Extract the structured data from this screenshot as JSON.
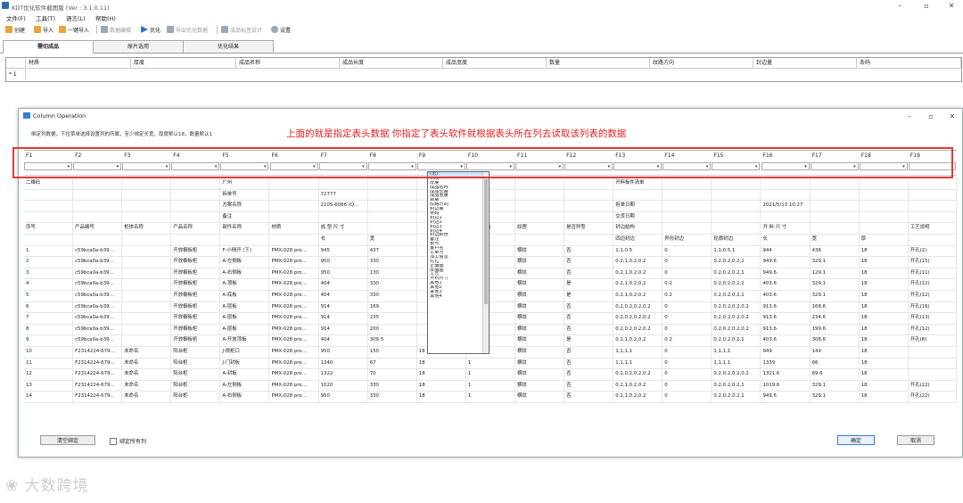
{
  "app": {
    "title": "KDT优化软件截图版 (Ver : 3.1.0.11)"
  },
  "menu": [
    "文件(F)",
    "工具(T)",
    "语言(L)",
    "帮助(H)"
  ],
  "toolbar": [
    {
      "label": "创建",
      "icon": "new-icon",
      "color": "#e8a33b"
    },
    {
      "label": "导入",
      "icon": "import-icon",
      "color": "#e8a33b"
    },
    {
      "label": "一键导入",
      "icon": "import-all-icon",
      "color": "#e8a33b"
    },
    {
      "label": "数据编辑",
      "icon": "edit-icon",
      "color": "#9aa7b4"
    },
    {
      "label": "优化",
      "icon": "play-icon",
      "color": "#2b6cd9"
    },
    {
      "label": "导出优化数据",
      "icon": "export-icon",
      "color": "#9aa7b4"
    },
    {
      "label": "成品标签设计",
      "icon": "label-icon",
      "color": "#9aa7b4"
    },
    {
      "label": "设置",
      "icon": "gear-icon",
      "color": "#9aa7b4"
    }
  ],
  "tabs": [
    "需切成品",
    "原片选用",
    "优化结果"
  ],
  "main_grid": {
    "columns": [
      "材质",
      "厚度",
      "成品名称",
      "成品长度",
      "成品宽度",
      "数量",
      "纹路方向",
      "封边量",
      "条码"
    ],
    "row_marker": "* 1"
  },
  "dialog": {
    "title": "Column Operation",
    "hint": "绑定列数据，下拉菜单选择设置列的所属，至少绑定长宽，厚度默认18，数量默认1",
    "annotation": "上面的就是指定表头数据  你指定了表头软件就根据表头所在列去读取该列表的数据",
    "col_headers": [
      "F1",
      "F2",
      "F3",
      "F4",
      "F5",
      "F6",
      "F7",
      "F8",
      "F9",
      "F10",
      "F11",
      "F12",
      "F13",
      "F14",
      "F15",
      "F16",
      "F17",
      "F18",
      "F19"
    ],
    "dropdown_options": [
      "(无)",
      "材质",
      "厚度",
      "成品名称",
      "成品长度",
      "成品宽度",
      "数量",
      "纹路方向",
      "封边量",
      "条码",
      "封边1",
      "封边2",
      "封边3",
      "封边4",
      "封边颜色",
      "备注",
      "柜号",
      "客户名",
      "订单号",
      "加工信息",
      "孔位",
      "正面图",
      "反面图",
      "工艺",
      "开料尺寸",
      "其他1",
      "其他2",
      "其他3",
      "其他4"
    ],
    "rows": [
      [
        "二维码",
        "",
        "",
        "",
        "广州",
        "",
        "",
        "",
        "",
        "",
        "",
        "",
        "开料板件清单",
        "",
        "",
        "",
        "",
        "",
        ""
      ],
      [
        "",
        "",
        "",
        "",
        "拆单号",
        "",
        "72777",
        "",
        "",
        "",
        "",
        "",
        "",
        "",
        "",
        "",
        "",
        "",
        ""
      ],
      [
        "",
        "",
        "",
        "",
        "方案名称",
        "",
        "2105-6066 (Q…",
        "",
        "",
        "",
        "",
        "",
        "拆单日期",
        "",
        "",
        "2021/5/13 10:27",
        "",
        "",
        ""
      ],
      [
        "",
        "",
        "",
        "",
        "备注",
        "",
        "",
        "",
        "",
        "",
        "",
        "",
        "交货日期",
        "",
        "",
        "",
        "",
        "",
        ""
      ],
      [
        "序号",
        "产品编号",
        "柜体名称",
        "产品名称",
        "部件名称",
        "材质",
        "成 型 尺 寸",
        "",
        "",
        "料数量(块)",
        "纹理",
        "是否异型",
        "封边结构",
        "",
        "",
        "开 料 尺 寸",
        "",
        "",
        "工艺说明"
      ],
      [
        "",
        "",
        "",
        "",
        "",
        "",
        "长",
        "宽",
        "",
        "",
        "",
        "",
        "四边封边",
        "异形封边",
        "轮廓封边",
        "长",
        "宽",
        "厚",
        ""
      ],
      [
        "1",
        "c59bca0a-b39…",
        "",
        "开放橱板柜",
        "F-小侧开 (下)",
        "PMX-028 pro…",
        "945",
        "437",
        "",
        "",
        "横纹",
        "否",
        "1,1,0.5",
        "0",
        "1,1,0.5,1",
        "944",
        "436",
        "18",
        "开孔(2)"
      ],
      [
        "2",
        "c59bca0a-b39…",
        "",
        "开放橱板柜",
        "A-左侧板",
        "PMX-028 pro…",
        "950",
        "330",
        "",
        "",
        "横纹",
        "否",
        "0.2,1,0.2,0.2",
        "0",
        "0.2,0.2,0.2,1",
        "949.6",
        "329.1",
        "18",
        "开孔(15)"
      ],
      [
        "3",
        "c59bca0a-b39…",
        "",
        "开放橱板柜",
        "A-右侧板",
        "PMX-028 pro…",
        "950",
        "130",
        "",
        "",
        "横纹",
        "否",
        "0.2,1,0.2,0.2",
        "0",
        "0.2,0.2,0.2,1",
        "949.6",
        "129.1",
        "18",
        "开孔(11)"
      ],
      [
        "4",
        "c59bca0a-b39…",
        "",
        "开放橱板柜",
        "A-顶板",
        "PMX-028 pro…",
        "404",
        "330",
        "",
        "",
        "横纹",
        "是",
        "0.2,1,0.2,0.2",
        "0.2",
        "0.2,0.2,0.2,1",
        "403.6",
        "329.1",
        "18",
        "开孔(12)"
      ],
      [
        "5",
        "c59bca0a-b39…",
        "",
        "开放橱板柜",
        "A-底板",
        "PMX-028 pro…",
        "404",
        "330",
        "",
        "",
        "横纹",
        "是",
        "0.2,1,0.2,0.2",
        "0.2",
        "0.2,0.2,0.2,1",
        "403.6",
        "329.1",
        "18",
        "开孔(12)"
      ],
      [
        "6",
        "c59bca0a-b39…",
        "",
        "开放橱板柜",
        "A-层板",
        "PMX-028 pro…",
        "914",
        "169",
        "",
        "",
        "横纹",
        "否",
        "0.2,0.2,0.2,0.2",
        "0",
        "0.2,0.2,0.2,0.2",
        "913.6",
        "168.6",
        "18",
        "开孔(16)"
      ],
      [
        "7",
        "c59bca0a-b39…",
        "",
        "开放橱板柜",
        "A-层板",
        "PMX-028 pro…",
        "914",
        "235",
        "",
        "",
        "横纹",
        "否",
        "0.2,0.2,0.2,0.2",
        "0",
        "0.2,0.2,0.2,0.2",
        "913.6",
        "234.6",
        "18",
        "开孔(13)"
      ],
      [
        "8",
        "c59bca0a-b39…",
        "",
        "开放橱板柜",
        "A-层板",
        "PMX-028 pro…",
        "914",
        "200",
        "",
        "",
        "横纹",
        "否",
        "0.2,0.2,0.2,0.2",
        "0",
        "0.2,0.2,0.2,0.2",
        "913.6",
        "199.6",
        "18",
        "开孔(12)"
      ],
      [
        "9",
        "c59bca0a-b39…",
        "",
        "开放橱板柜",
        "A-开放顶板",
        "PMX-028 pro…",
        "404",
        "309.5",
        "",
        "",
        "横纹",
        "是",
        "0.2,1,0.2,0.2",
        "0.2",
        "0.2,0.2,0.2,1",
        "403.6",
        "308.6",
        "18",
        "开孔(8)"
      ],
      [
        "10",
        "F2314224-679…",
        "未命名",
        "阳台柜",
        "J-侧柜口",
        "PMX-028 pro…",
        "950",
        "150",
        "18",
        "1",
        "横纹",
        "否",
        "1,1,1,1",
        "0",
        "1,1,1,1",
        "949",
        "149",
        "18",
        ""
      ],
      [
        "11",
        "F2314224-679…",
        "未命名",
        "阳台柜",
        "J-门封板",
        "PMX-028 pro…",
        "1340",
        "67",
        "18",
        "1",
        "横纹",
        "否",
        "1,1,1,1",
        "0",
        "1,1,1,1",
        "1339",
        "66",
        "18",
        ""
      ],
      [
        "12",
        "F2314224-679…",
        "未命名",
        "阳台柜",
        "A-封板",
        "PMX-028 pro…",
        "1322",
        "70",
        "18",
        "1",
        "横纹",
        "否",
        "0.2,0.2,0.2,0.2",
        "0",
        "0.2,0.2,0.2,0.2",
        "1321.6",
        "69.6",
        "18",
        ""
      ],
      [
        "13",
        "F2314224-679…",
        "未命名",
        "阳台柜",
        "A-左侧板",
        "PMX-028 pro…",
        "1020",
        "330",
        "18",
        "1",
        "横纹",
        "否",
        "0.2,1,0.2,0.2",
        "0",
        "0.2,0.2,0.2,1",
        "1019.6",
        "329.1",
        "18",
        "开孔(22)"
      ],
      [
        "14",
        "F2314224-679…",
        "未命名",
        "阳台柜",
        "A-右侧板",
        "PMX-028 pro…",
        "950",
        "330",
        "18",
        "1",
        "横纹",
        "否",
        "0.2,1,0.2,0.2",
        "0",
        "0.2,0.2,0.2,1",
        "949.6",
        "329.1",
        "18",
        "开孔(22)"
      ]
    ],
    "btn_clear": "清空绑定",
    "chk_bind_all": "绑定所有列",
    "btn_ok": "确定",
    "btn_cancel": "取消"
  },
  "watermark": "大数跨境"
}
